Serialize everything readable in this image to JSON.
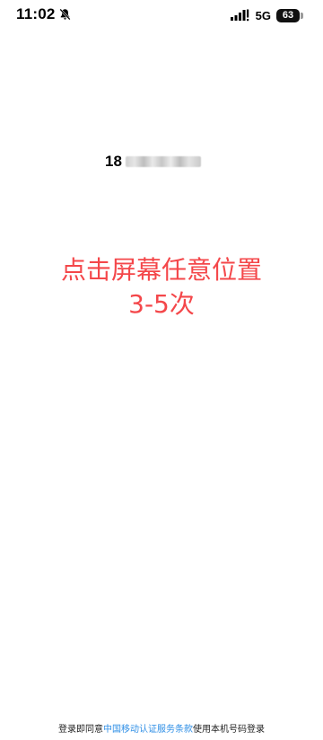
{
  "status_bar": {
    "time": "11:02",
    "network": "5G",
    "battery": "63"
  },
  "phone": {
    "prefix": "18"
  },
  "instruction": {
    "line1": "点击屏幕任意位置",
    "line2": "3-5次",
    "color": "#f4474a"
  },
  "agreement": {
    "prefix": "登录即同意",
    "link": "中国移动认证服务条款",
    "suffix": "使用本机号码登录",
    "link_color": "#2f8fe6"
  }
}
